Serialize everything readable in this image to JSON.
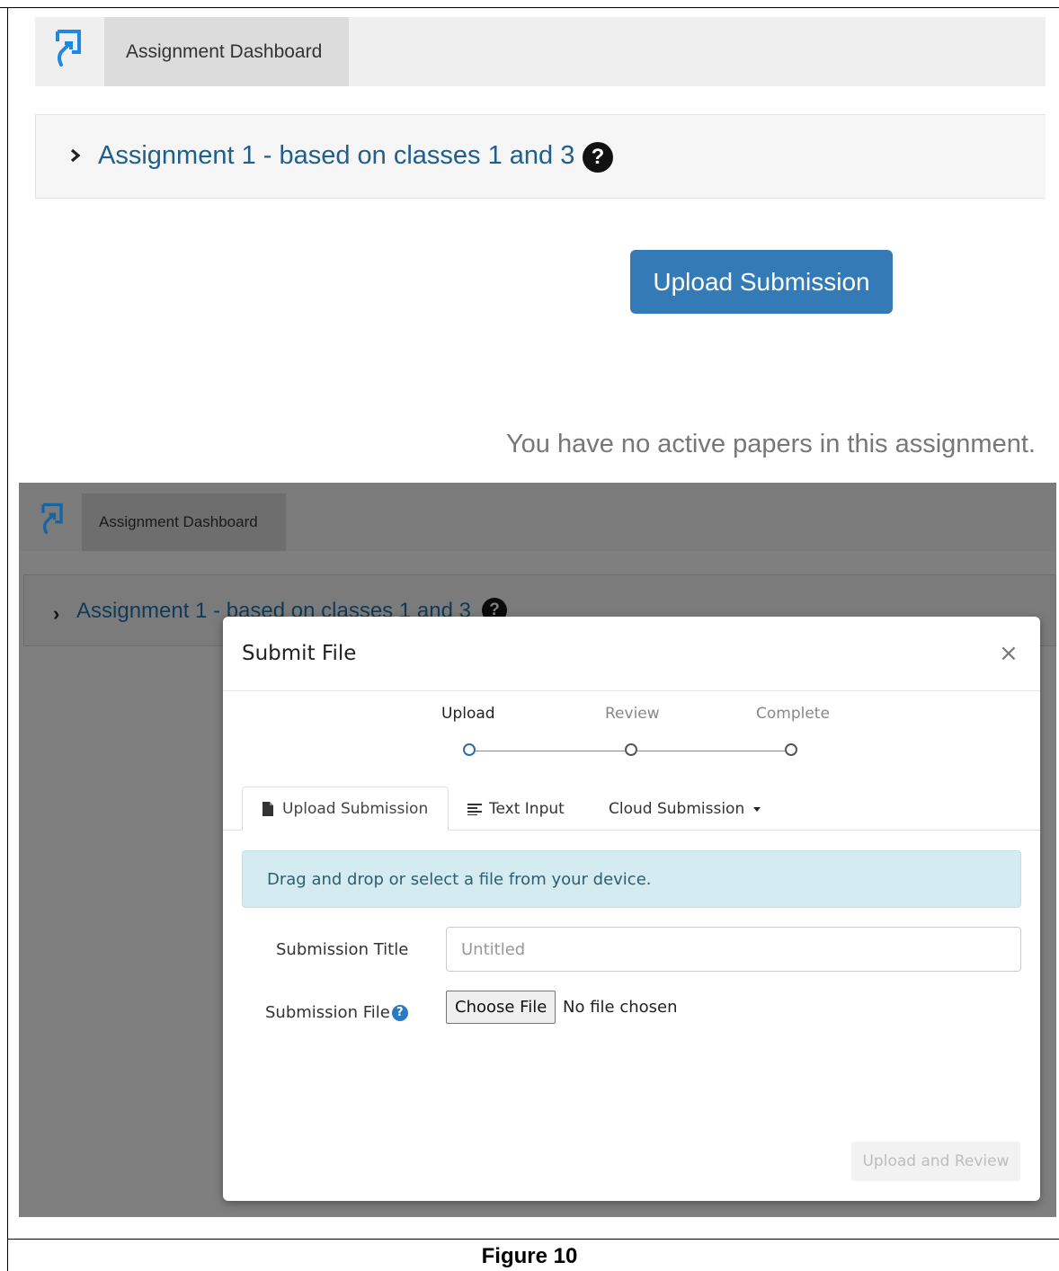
{
  "colors": {
    "accent_blue": "#337ab7",
    "link_blue": "#1f5f8b",
    "alert_bg": "#d4ebf1",
    "overlay_gray": "#7f7f7f"
  },
  "top_screenshot": {
    "nav": {
      "logo_icon": "turnitin-logo-icon",
      "tab_label": "Assignment Dashboard"
    },
    "assignment": {
      "chevron_icon": "chevron-right-icon",
      "title": "Assignment 1 - based on classes 1 and 3",
      "help_icon": "question-circle-icon",
      "help_glyph": "?"
    },
    "upload_button_label": "Upload Submission",
    "empty_message": "You have no active papers in this assignment."
  },
  "bottom_screenshot": {
    "nav": {
      "logo_icon": "turnitin-logo-icon",
      "tab_label": "Assignment Dashboard"
    },
    "assignment": {
      "chevron_glyph": "›",
      "title": "Assignment 1 - based on classes 1 and 3",
      "help_glyph": "?"
    },
    "modal": {
      "title": "Submit File",
      "close_glyph": "×",
      "steps": [
        {
          "label": "Upload",
          "active": true
        },
        {
          "label": "Review",
          "active": false
        },
        {
          "label": "Complete",
          "active": false
        }
      ],
      "tabs": {
        "upload": {
          "label": "Upload Submission",
          "icon": "file-icon"
        },
        "text": {
          "label": "Text Input",
          "icon": "align-left-icon"
        },
        "cloud": {
          "label": "Cloud Submission",
          "icon": "caret-down-icon"
        }
      },
      "alert_text": "Drag and drop or select a file from your device.",
      "form": {
        "title_label": "Submission Title",
        "title_placeholder": "Untitled",
        "file_label": "Submission File",
        "file_help_glyph": "?",
        "choose_file_label": "Choose File",
        "no_file_text": "No file chosen"
      },
      "submit_label": "Upload and Review"
    }
  },
  "caption": "Figure 10"
}
